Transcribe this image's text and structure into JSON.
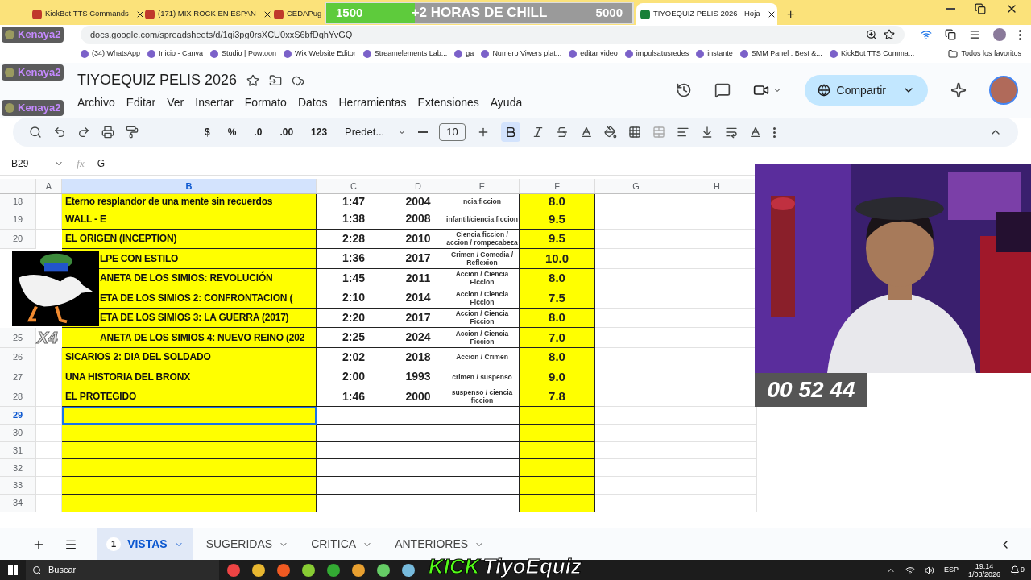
{
  "browser": {
    "tabs": [
      {
        "label": "KickBot TTS Commands",
        "selected": false
      },
      {
        "label": "(171) MIX ROCK EN ESPAÑ",
        "selected": false
      },
      {
        "label": "CEDAPug",
        "selected": false
      },
      {
        "label": "TIYOEQUIZ PELIS 2026 - Hoja",
        "selected": true
      }
    ],
    "new_tab": "+",
    "url": "docs.google.com/spreadsheets/d/1qi3pg0rsXCU0xxS6bfDqhYvGQ",
    "bookmarks": [
      "(34) WhatsApp",
      "Inicio - Canva",
      "Studio | Powtoon",
      "Wix Website Editor",
      "Streamelements Lab...",
      "ga",
      "Numero Viwers plat...",
      "editar video",
      "impulsatusredes",
      "instante",
      "SMM Panel : Best &...",
      "KickBot TTS Comma..."
    ],
    "all_bookmarks": "Todos los favoritos"
  },
  "sheet": {
    "title": "TIYOEQUIZ PELIS 2026",
    "menu": [
      "Archivo",
      "Editar",
      "Ver",
      "Insertar",
      "Formato",
      "Datos",
      "Herramientas",
      "Extensiones",
      "Ayuda"
    ],
    "share": "Compartir",
    "toolbar": {
      "formats": [
        "$",
        "%",
        ".0",
        ".00",
        "123"
      ],
      "font": "Predet...",
      "size": "10",
      "bold": true
    },
    "name_box": "B29",
    "fx_label": "fx",
    "fx": "G",
    "columns": [
      {
        "label": "A",
        "selected": false
      },
      {
        "label": "B",
        "selected": true
      },
      {
        "label": "C",
        "selected": false
      },
      {
        "label": "D",
        "selected": false
      },
      {
        "label": "E",
        "selected": false
      },
      {
        "label": "F",
        "selected": false
      },
      {
        "label": "G",
        "selected": false
      },
      {
        "label": "H",
        "selected": false
      }
    ],
    "rows": [
      {
        "num": "18",
        "title": "Eterno resplandor de una mente sin recuerdos",
        "duration": "1:47",
        "year": "2004",
        "genre": "ncia ficcion",
        "score": "8.0",
        "covered": false,
        "selected": false
      },
      {
        "num": "19",
        "title": "WALL - E",
        "duration": "1:38",
        "year": "2008",
        "genre": "infantil/ciencia ficcion",
        "score": "9.5",
        "covered": false,
        "selected": false
      },
      {
        "num": "20",
        "title": "EL ORIGEN (INCEPTION)",
        "duration": "2:28",
        "year": "2010",
        "genre": "Ciencia ficcion / accion / rompecabeza",
        "score": "9.5",
        "covered": false,
        "selected": false
      },
      {
        "title": "LPE CON ESTILO",
        "duration": "1:36",
        "year": "2017",
        "genre": "Crimen / Comedia / Reflexion",
        "score": "10.0",
        "covered": true,
        "selected": false
      },
      {
        "title": "ANETA DE LOS SIMIOS: REVOLUCIÓN",
        "duration": "1:45",
        "year": "2011",
        "genre": "Accion / Ciencia Ficcion",
        "score": "8.0",
        "covered": true,
        "selected": false
      },
      {
        "title": "ETA DE LOS SIMIOS 2: CONFRONTACION (",
        "duration": "2:10",
        "year": "2014",
        "genre": "Accion / Ciencia Ficcion",
        "score": "7.5",
        "covered": true,
        "selected": false
      },
      {
        "title": "ETA DE LOS SIMIOS 3: LA GUERRA (2017)",
        "duration": "2:20",
        "year": "2017",
        "genre": "Accion / Ciencia Ficcion",
        "score": "8.0",
        "covered": true,
        "selected": false
      },
      {
        "num": "25",
        "title": "ANETA DE LOS SIMIOS 4: NUEVO REINO (202",
        "duration": "2:25",
        "year": "2024",
        "genre": "Accion / Ciencia Ficcion",
        "score": "7.0",
        "covered": true,
        "selected": false
      },
      {
        "num": "26",
        "title": "SICARIOS 2: DIA DEL SOLDADO",
        "duration": "2:02",
        "year": "2018",
        "genre": "Accion / Crimen",
        "score": "8.0",
        "covered": false,
        "selected": false
      },
      {
        "num": "27",
        "title": "UNA HISTORIA DEL BRONX",
        "duration": "2:00",
        "year": "1993",
        "genre": "crimen / suspenso",
        "score": "9.0",
        "covered": false,
        "selected": false
      },
      {
        "num": "28",
        "title": "EL PROTEGIDO",
        "duration": "1:46",
        "year": "2000",
        "genre": "suspenso / ciencia ficcion",
        "score": "7.8",
        "covered": false,
        "selected": false
      },
      {
        "num": "29",
        "selected": true
      },
      {
        "num": "30",
        "selected": false
      },
      {
        "num": "31",
        "selected": false
      },
      {
        "num": "32",
        "selected": false
      },
      {
        "num": "33",
        "selected": false
      },
      {
        "num": "34",
        "selected": false
      }
    ],
    "sheet_tabs": [
      {
        "label": "VISTAS",
        "badge": "1",
        "selected": true
      },
      {
        "label": "SUGERIDAS",
        "selected": false
      },
      {
        "label": "CRITICA",
        "selected": false
      },
      {
        "label": "ANTERIORES",
        "selected": false
      }
    ]
  },
  "overlay": {
    "chat": [
      "Kenaya2",
      "Kenaya2",
      "Kenaya2"
    ],
    "goal": {
      "start": "1500",
      "label": "+2 HORAS DE CHILL",
      "end": "5000",
      "level": 0.29
    },
    "sticker": {
      "label": "X4"
    },
    "timer": "00 52 44",
    "brand": {
      "kick": "KICK",
      "name": "TiyoEquiz"
    }
  },
  "taskbar": {
    "search": "Buscar",
    "lang": "ESP",
    "time": "19:14",
    "date": "1/03/2026",
    "notifications": "9"
  }
}
